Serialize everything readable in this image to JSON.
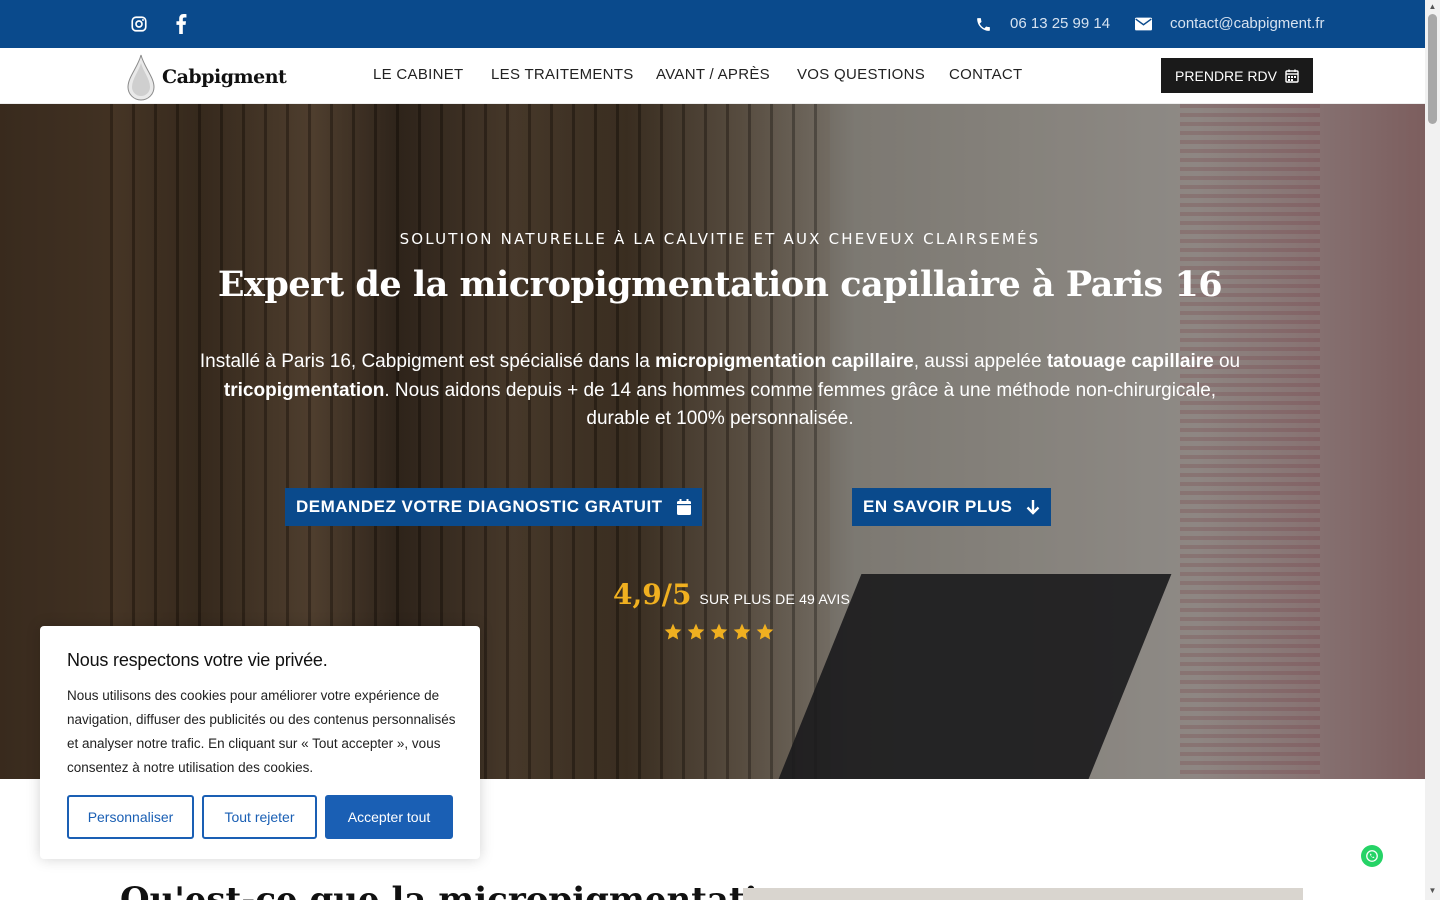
{
  "topbar": {
    "phone": "06 13 25 99 14",
    "email": "contact@cabpigment.fr",
    "social": [
      "instagram-icon",
      "facebook-icon"
    ]
  },
  "nav": {
    "logo": "Cabpigment",
    "items": [
      "LE CABINET",
      "LES TRAITEMENTS",
      "AVANT / APRÈS",
      "VOS QUESTIONS",
      "CONTACT"
    ],
    "cta": "PRENDRE RDV"
  },
  "hero": {
    "kicker": "SOLUTION NATURELLE À LA CALVITIE ET AUX CHEVEUX CLAIRSEMÉS",
    "title": "Expert de la micropigmentation capillaire à Paris 16",
    "desc_1": "Installé à Paris 16, Cabpigment est spécialisé dans la ",
    "desc_b1": "micropigmentation capillaire",
    "desc_2": ", aussi appelée ",
    "desc_b2": "tatouage capillaire",
    "desc_3": " ou ",
    "desc_b3": "tricopigmentation",
    "desc_4": ". Nous aidons depuis + de 14 ans hommes comme femmes grâce à une méthode non-chirurgicale, durable et 100% personnalisée.",
    "btn_diagnostic": "DEMANDEZ VOTRE DIAGNOSTIC GRATUIT",
    "btn_more": "EN SAVOIR PLUS",
    "rating_score": "4,9/5",
    "rating_label": "SUR PLUS DE 49 AVIS",
    "stars": 5
  },
  "below": {
    "title_partial": "Qu'est-ce que la micropigmentation"
  },
  "cookie": {
    "title": "Nous respectons votre vie privée.",
    "text": "Nous utilisons des cookies pour améliorer votre expérience de navigation, diffuser des publicités ou des contenus personnalisés et analyser notre trafic. En cliquant sur « Tout accepter », vous consentez à notre utilisation des cookies.",
    "btn_customize": "Personnaliser",
    "btn_reject": "Tout rejeter",
    "btn_accept": "Accepter tout"
  },
  "colors": {
    "brand_blue": "#0a4a8c",
    "accent_gold": "#f0b020",
    "cookie_blue": "#1a5fb4"
  }
}
